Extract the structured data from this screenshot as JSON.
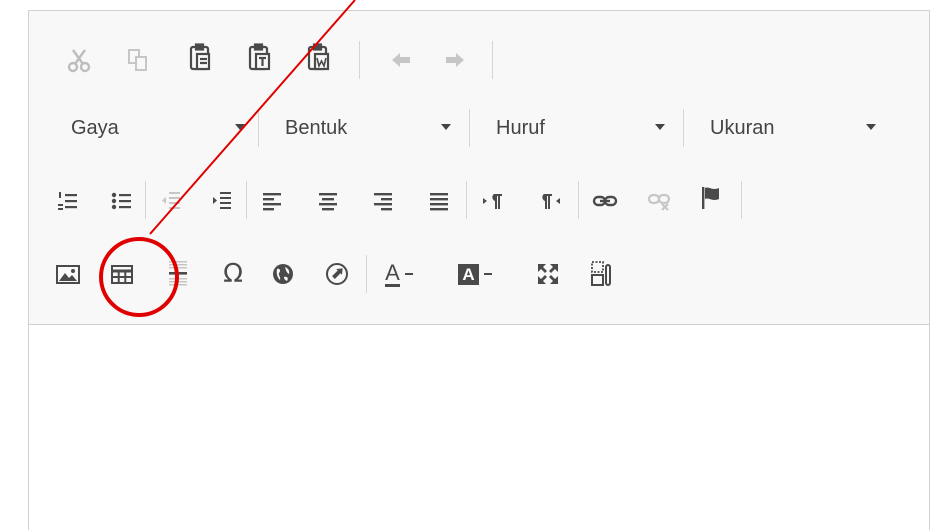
{
  "colors": {
    "icon": "#4a4a4a",
    "icon_disabled": "#c6c6c6",
    "annotation": "#e00000"
  },
  "row1": [
    {
      "name": "cut-icon",
      "label": "Cut"
    },
    {
      "name": "copy-icon",
      "label": "Copy"
    },
    {
      "name": "paste-icon",
      "label": "Paste"
    },
    {
      "name": "paste-text-icon",
      "label": "Paste as plain text"
    },
    {
      "name": "paste-word-icon",
      "label": "Paste from Word"
    },
    {
      "name": "undo-icon",
      "label": "Undo"
    },
    {
      "name": "redo-icon",
      "label": "Redo"
    }
  ],
  "combos": {
    "gaya": "Gaya",
    "bentuk": "Bentuk",
    "huruf": "Huruf",
    "ukuran": "Ukuran"
  },
  "row3": [
    "numbered-list-icon",
    "bulleted-list-icon",
    "outdent-icon",
    "indent-icon",
    "align-left-icon",
    "align-center-icon",
    "align-right-icon",
    "justify-icon",
    "ltr-icon",
    "rtl-icon",
    "link-icon",
    "unlink-icon",
    "anchor-flag-icon"
  ],
  "row4": [
    "image-icon",
    "table-icon",
    "horizontal-line-icon",
    "special-char-icon",
    "iframe-globe-icon",
    "source-icon",
    "text-color-icon",
    "bg-color-icon",
    "maximize-icon",
    "show-blocks-icon"
  ],
  "glyphs": {
    "omega": "Ω",
    "text_color_letter": "A",
    "bg_color_letter": "A"
  },
  "annotation": {
    "highlighted": "table-icon"
  }
}
